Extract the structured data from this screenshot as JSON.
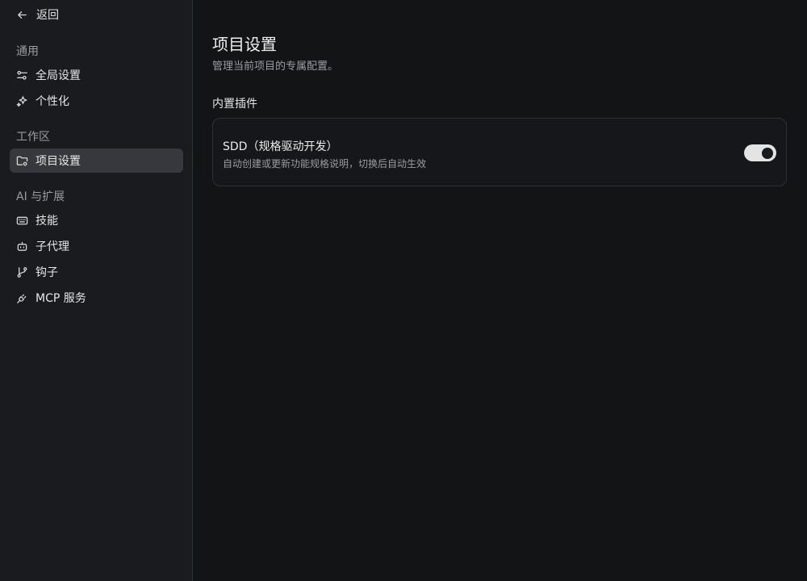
{
  "sidebar": {
    "back_label": "返回",
    "sections": [
      {
        "label": "通用",
        "items": [
          {
            "label": "全局设置",
            "icon": "sliders-icon"
          },
          {
            "label": "个性化",
            "icon": "sparkles-icon"
          }
        ]
      },
      {
        "label": "工作区",
        "items": [
          {
            "label": "项目设置",
            "icon": "folder-settings-icon",
            "active": true
          }
        ]
      },
      {
        "label": "AI 与扩展",
        "items": [
          {
            "label": "技能",
            "icon": "keyboard-icon"
          },
          {
            "label": "子代理",
            "icon": "bot-icon"
          },
          {
            "label": "钩子",
            "icon": "git-branch-icon"
          },
          {
            "label": "MCP 服务",
            "icon": "plug-icon"
          }
        ]
      }
    ]
  },
  "main": {
    "title": "项目设置",
    "subtitle": "管理当前项目的专属配置。",
    "group_title": "内置插件",
    "plugins": [
      {
        "name": "SDD（规格驱动开发）",
        "description": "自动创建或更新功能规格说明，切换后自动生效",
        "enabled": true
      }
    ]
  },
  "colors": {
    "background": "#131416",
    "sidebar": "#1a1b1e",
    "active_item": "#36383d",
    "toggle_on": "#e4e4e4"
  }
}
